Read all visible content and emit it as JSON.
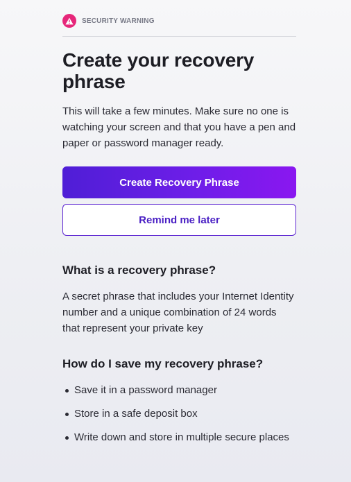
{
  "warning": {
    "icon": "warning-triangle-icon",
    "label": "SECURITY WARNING",
    "color": "#e6267a"
  },
  "title": "Create your recovery phrase",
  "intro": "This will take a few minutes. Make sure no one is watching your screen and that you have a pen and paper or password manager ready.",
  "buttons": {
    "primary": "Create Recovery Phrase",
    "secondary": "Remind me later"
  },
  "section_what": {
    "heading": "What is a recovery phrase?",
    "body": "A secret phrase that includes your Internet Identity number and a unique combination of 24 words that represent your private key"
  },
  "section_how": {
    "heading": "How do I save my recovery phrase?",
    "items": [
      "Save it in a password manager",
      "Store in a safe deposit box",
      "Write down and store in multiple secure places"
    ]
  },
  "colors": {
    "accent": "#5a22d1",
    "primary_gradient_start": "#4f1ed6",
    "primary_gradient_end": "#8a17f0"
  }
}
